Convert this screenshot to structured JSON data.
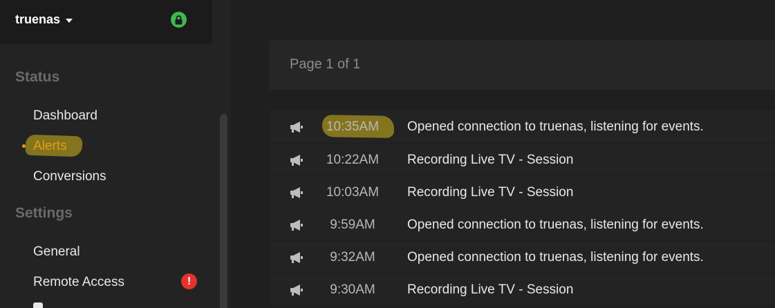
{
  "server": {
    "name": "truenas",
    "lock_icon": "lock-icon",
    "accent": "#3fb950"
  },
  "sidebar": {
    "sections": [
      {
        "title": "Status",
        "items": [
          {
            "label": "Dashboard"
          },
          {
            "label": "Alerts",
            "active": true
          },
          {
            "label": "Conversions"
          }
        ]
      },
      {
        "title": "Settings",
        "items": [
          {
            "label": "General"
          },
          {
            "label": "Remote Access",
            "badge": "!",
            "badge_color": "#e5322d"
          }
        ]
      }
    ],
    "active_color": "#e5a00d"
  },
  "main": {
    "pager": {
      "label": "Page 1 of 1"
    },
    "alerts": [
      {
        "time": "10:35AM",
        "message": "Opened connection to truenas, listening for events.",
        "icon": "megaphone-icon",
        "highlighted": true
      },
      {
        "time": "10:22AM",
        "message": "Recording Live TV - Session",
        "icon": "megaphone-icon"
      },
      {
        "time": "10:03AM",
        "message": "Recording Live TV - Session",
        "icon": "megaphone-icon"
      },
      {
        "time": "9:59AM",
        "message": "Opened connection to truenas, listening for events.",
        "icon": "megaphone-icon"
      },
      {
        "time": "9:32AM",
        "message": "Opened connection to truenas, listening for events.",
        "icon": "megaphone-icon"
      },
      {
        "time": "9:30AM",
        "message": "Recording Live TV - Session",
        "icon": "megaphone-icon"
      }
    ]
  }
}
